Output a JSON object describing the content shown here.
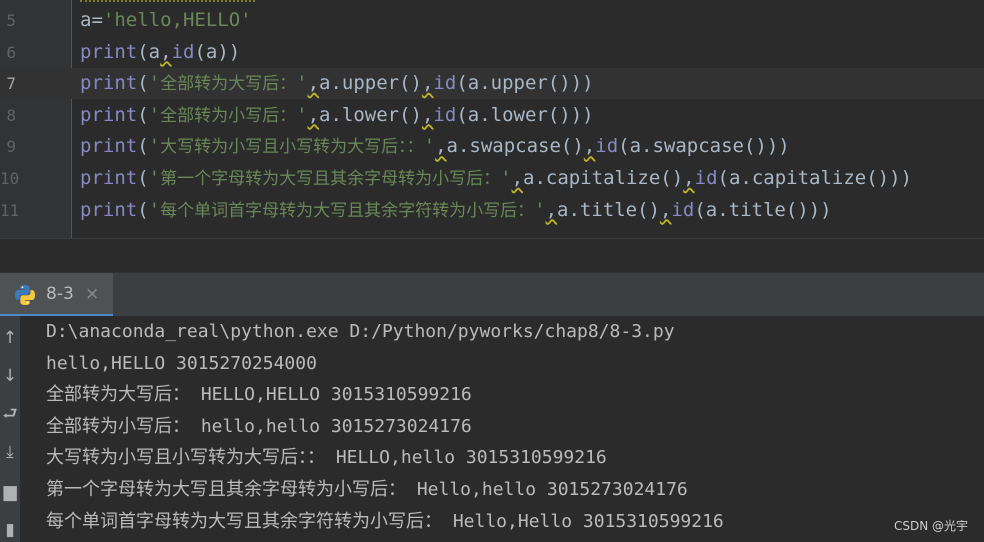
{
  "editor": {
    "lines": [
      {
        "num": "5",
        "parts": [
          [
            "var",
            "a="
          ],
          [
            "str",
            "'hello,HELLO'"
          ]
        ]
      },
      {
        "num": "6",
        "parts": [
          [
            "kw",
            "print"
          ],
          [
            "p",
            "(a"
          ],
          [
            "sq",
            ","
          ],
          [
            "kw",
            "id"
          ],
          [
            "p",
            "(a))"
          ]
        ]
      },
      {
        "num": "7",
        "current": true,
        "parts": [
          [
            "kw",
            "print"
          ],
          [
            "p",
            "("
          ],
          [
            "str",
            "'"
          ],
          [
            "cjk",
            "全部转为大写后："
          ],
          [
            "str",
            "'"
          ],
          [
            "sq",
            ","
          ],
          [
            "p",
            "a.upper()"
          ],
          [
            "sq",
            ","
          ],
          [
            "kw",
            "id"
          ],
          [
            "p",
            "(a.upper()))"
          ]
        ]
      },
      {
        "num": "8",
        "parts": [
          [
            "kw",
            "print"
          ],
          [
            "p",
            "("
          ],
          [
            "str",
            "'"
          ],
          [
            "cjk",
            "全部转为小写后："
          ],
          [
            "str",
            "'"
          ],
          [
            "sq",
            ","
          ],
          [
            "p",
            "a.lower()"
          ],
          [
            "sq",
            ","
          ],
          [
            "kw",
            "id"
          ],
          [
            "p",
            "(a.lower()))"
          ]
        ]
      },
      {
        "num": "9",
        "parts": [
          [
            "kw",
            "print"
          ],
          [
            "p",
            "("
          ],
          [
            "str",
            "'"
          ],
          [
            "cjk",
            "大写转为小写且小写转为大写后：："
          ],
          [
            "str",
            "'"
          ],
          [
            "sq",
            ","
          ],
          [
            "p",
            "a.swapcase()"
          ],
          [
            "sq",
            ","
          ],
          [
            "kw",
            "id"
          ],
          [
            "p",
            "(a.swapcase()))"
          ]
        ]
      },
      {
        "num": "10",
        "parts": [
          [
            "kw",
            "print"
          ],
          [
            "p",
            "("
          ],
          [
            "str",
            "'"
          ],
          [
            "cjk",
            "第一个字母转为大写且其余字母转为小写后："
          ],
          [
            "str",
            "'"
          ],
          [
            "sq",
            ","
          ],
          [
            "p",
            "a.capitalize()"
          ],
          [
            "sq",
            ","
          ],
          [
            "kw",
            "id"
          ],
          [
            "p",
            "(a.capitalize()))"
          ]
        ]
      },
      {
        "num": "11",
        "parts": [
          [
            "kw",
            "print"
          ],
          [
            "p",
            "("
          ],
          [
            "str",
            "'"
          ],
          [
            "cjk",
            "每个单词首字母转为大写且其余字符转为小写后："
          ],
          [
            "str",
            "'"
          ],
          [
            "sq",
            ","
          ],
          [
            "p",
            "a.title()"
          ],
          [
            "sq",
            ","
          ],
          [
            "kw",
            "id"
          ],
          [
            "p",
            "(a.title()))"
          ]
        ]
      }
    ]
  },
  "run": {
    "tab_label": "8-3",
    "tab_close": "×",
    "output": [
      "D:\\anaconda_real\\python.exe D:/Python/pyworks/chap8/8-3.py",
      "hello,HELLO 3015270254000",
      "全部转为大写后： HELLO,HELLO 3015310599216",
      "全部转为小写后： hello,hello 3015273024176",
      "大写转为小写且小写转为大写后：： HELLO,hello 3015310599216",
      "第一个字母转为大写且其余字母转为小写后： Hello,hello 3015273024176",
      "每个单词首字母转为大写且其余字符转为小写后： Hello,Hello 3015310599216"
    ],
    "side_icons": [
      "up-arrow-icon",
      "down-arrow-icon",
      "soft-wrap-icon",
      "scroll-to-end-icon",
      "print-icon",
      "trash-icon"
    ]
  },
  "watermark": "CSDN @光宇",
  "colors": {
    "background": "#2b2b2b",
    "keyword": "#8888c6",
    "string": "#6a8759",
    "text": "#a9b7c6",
    "accent": "#4a88c7"
  }
}
